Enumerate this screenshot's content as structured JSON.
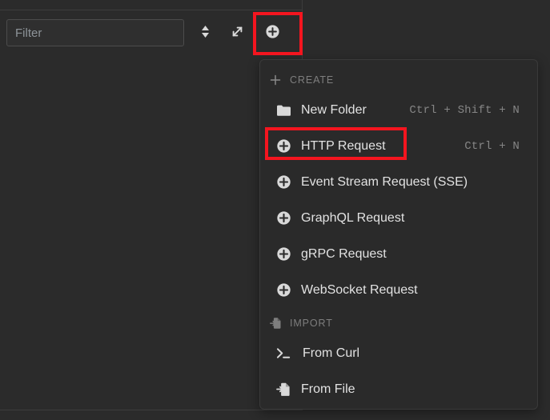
{
  "toolbar": {
    "filter": {
      "placeholder": "Filter",
      "value": ""
    },
    "sort_button": {
      "name": "sort-button",
      "icon": "sort-updown-icon"
    },
    "expand_button": {
      "name": "expand-button",
      "icon": "expand-diagonal-icon"
    },
    "add_button": {
      "name": "add-button",
      "icon": "plus-circle-icon"
    }
  },
  "menu": {
    "sections": [
      {
        "id": "create",
        "label": "CREATE",
        "icon": "plus-icon",
        "items": [
          {
            "label": "New Folder",
            "icon": "folder-icon",
            "shortcut": "Ctrl + Shift + N",
            "name": "menu-item-new-folder"
          },
          {
            "label": "HTTP Request",
            "icon": "plus-circle-icon",
            "shortcut": "Ctrl + N",
            "name": "menu-item-http-request"
          },
          {
            "label": "Event Stream Request (SSE)",
            "icon": "plus-circle-icon",
            "shortcut": "",
            "name": "menu-item-event-stream-request"
          },
          {
            "label": "GraphQL Request",
            "icon": "plus-circle-icon",
            "shortcut": "",
            "name": "menu-item-graphql-request"
          },
          {
            "label": "gRPC Request",
            "icon": "plus-circle-icon",
            "shortcut": "",
            "name": "menu-item-grpc-request"
          },
          {
            "label": "WebSocket Request",
            "icon": "plus-circle-icon",
            "shortcut": "",
            "name": "menu-item-websocket-request"
          }
        ]
      },
      {
        "id": "import",
        "label": "IMPORT",
        "icon": "file-import-icon",
        "items": [
          {
            "label": "From Curl",
            "icon": "terminal-icon",
            "shortcut": "",
            "name": "menu-item-from-curl"
          },
          {
            "label": "From File",
            "icon": "file-import-icon",
            "shortcut": "",
            "name": "menu-item-from-file"
          }
        ]
      }
    ]
  },
  "annotations": [
    {
      "target": "add-button",
      "color": "#f4151f"
    },
    {
      "target": "menu-item-http-request",
      "color": "#f4151f"
    }
  ],
  "colors": {
    "background": "#2b2b2b",
    "menu_background": "#2a2a2a",
    "menu_border": "#3a3a3a",
    "text_primary": "#e2e2e2",
    "text_muted": "#7e7e7e",
    "shortcut_text": "#868686",
    "placeholder": "#8e9499",
    "annotation_red": "#f4151f"
  }
}
